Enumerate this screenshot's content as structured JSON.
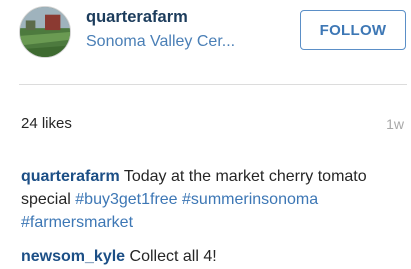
{
  "post": {
    "username": "quarterafarm",
    "location": "Sonoma Valley Cer...",
    "follow_label": "FOLLOW",
    "avatar_icon": "farm-field-photo",
    "likes": "24 likes",
    "timestamp": "1w"
  },
  "caption": {
    "author": "quarterafarm",
    "text": "Today at the market cherry tomato special",
    "tags": [
      "#buy3get1free",
      "#summerinsonoma",
      "#farmersmarket"
    ]
  },
  "comments": [
    {
      "author": "newsom_kyle",
      "text": "Collect all 4!"
    }
  ],
  "colors": {
    "username": "#1c3c5c",
    "link": "#3d77b5",
    "muted": "#a8a8a8"
  }
}
